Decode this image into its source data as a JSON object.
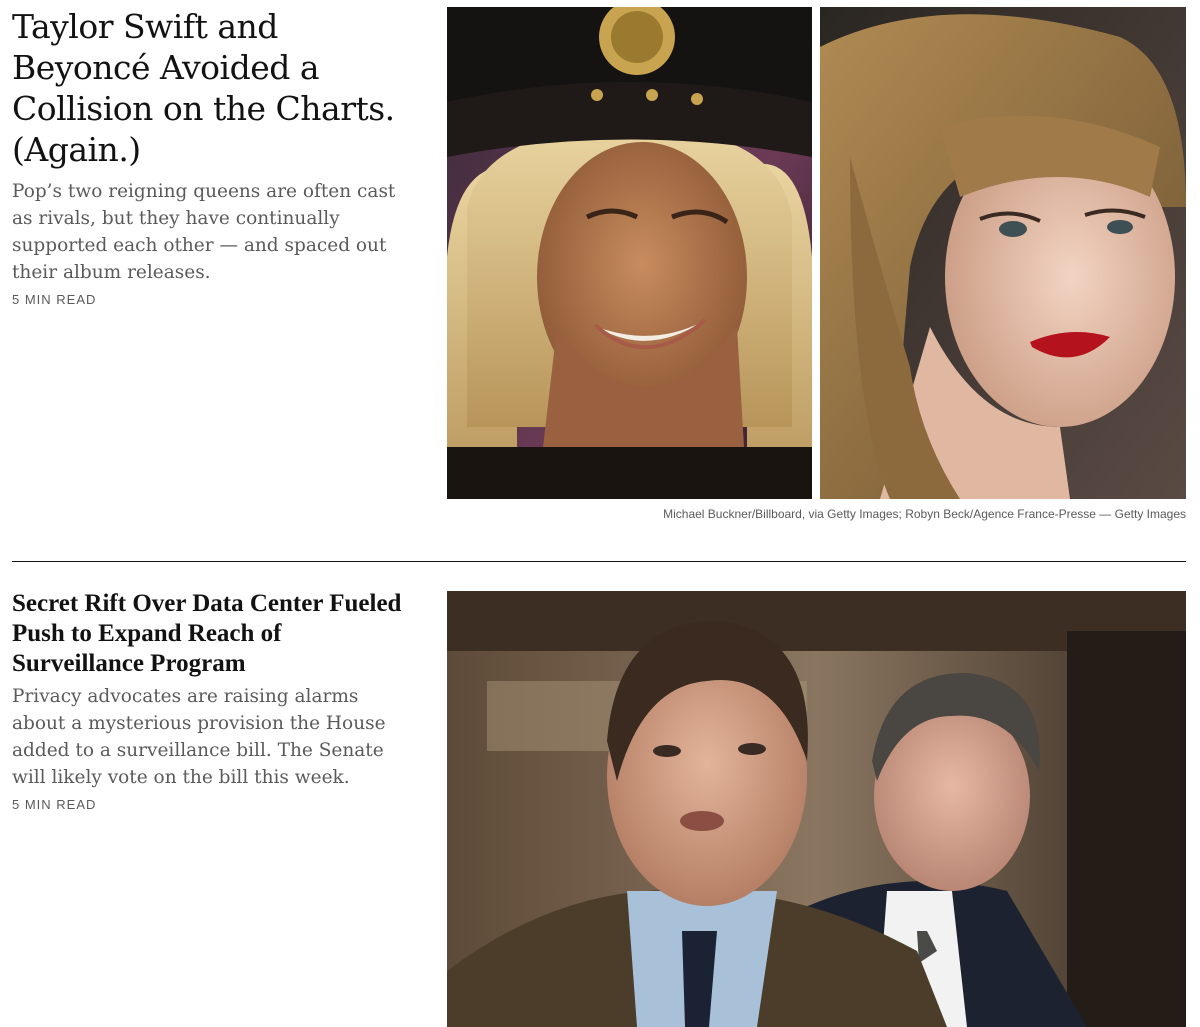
{
  "stories": [
    {
      "headline": "Taylor Swift and Beyoncé Avoided a Collision on the Charts. (Again.)",
      "summary": "Pop’s two reigning queens are often cast as rivals, but they have continually supported each other — and spaced out their album releases.",
      "read_time": "5 MIN READ",
      "caption": "Michael Buckner/Billboard, via Getty Images; Robyn Beck/Agence France-Presse — Getty Images"
    },
    {
      "headline": "Secret Rift Over Data Center Fueled Push to Expand Reach of Surveillance Program",
      "summary": "Privacy advocates are raising alarms about a mysterious provision the House added to a surveillance bill. The Senate will likely vote on the bill this week.",
      "read_time": "5 MIN READ"
    }
  ]
}
